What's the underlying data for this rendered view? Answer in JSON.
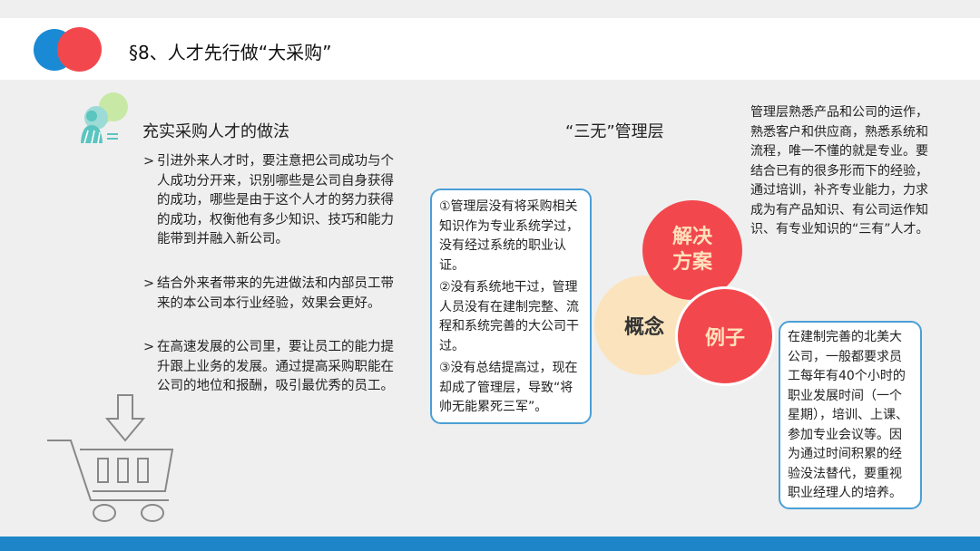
{
  "slide": {
    "title": "§8、人才先行做“大采购”",
    "colors": {
      "brand_blue": "#1a8ad4",
      "brand_red": "#f2484d",
      "bottom_bar": "#1e86c8",
      "box_border": "#4a9fd6",
      "concept_circle": "#fbe4bd"
    }
  },
  "left": {
    "heading": "充实采购人才的做法",
    "icons": {
      "people": "people-chat-icon",
      "cart": "shopping-cart-icon"
    },
    "bullets": [
      {
        "marker": ">",
        "text": "引进外来人才时，要注意把公司成功与个人成功分开来，识别哪些是公司自身获得的成功，哪些是由于这个人才的努力获得的成功，权衡他有多少知识、技巧和能力能带到并融入新公司。"
      },
      {
        "marker": ">",
        "text": "结合外来者带来的先进做法和内部员工带来的本公司本行业经验，效果会更好。"
      },
      {
        "marker": ">",
        "text": "在高速发展的公司里，要让员工的能力提升跟上业务的发展。通过提高采购职能在公司的地位和报酬，吸引最优秀的员工。"
      }
    ]
  },
  "center": {
    "label": "“三无”管理层",
    "box_items": [
      "①管理层没有将采购相关知识作为专业系统学过，没有经过系统的职业认证。",
      "②没有系统地干过，管理人员没有在建制完整、流程和系统完善的大公司干过。",
      "③没有总结提高过，现在却成了管理层，导致“将帅无能累死三军”。"
    ],
    "circles": {
      "solution": "解决方案",
      "concept": "概念",
      "example": "例子"
    }
  },
  "right": {
    "solution_text": "管理层熟悉产品和公司的运作，熟悉客户和供应商，熟悉系统和流程，唯一不懂的就是专业。要结合已有的很多形而下的经验，通过培训，补齐专业能力，力求成为有产品知识、有公司运作知识、有专业知识的“三有”人才。",
    "example_text": "在建制完善的北美大公司，一般都要求员工每年有40个小时的职业发展时间（一个星期），培训、上课、参加专业会议等。因为通过时间积累的经验没法替代，要重视职业经理人的培养。"
  }
}
